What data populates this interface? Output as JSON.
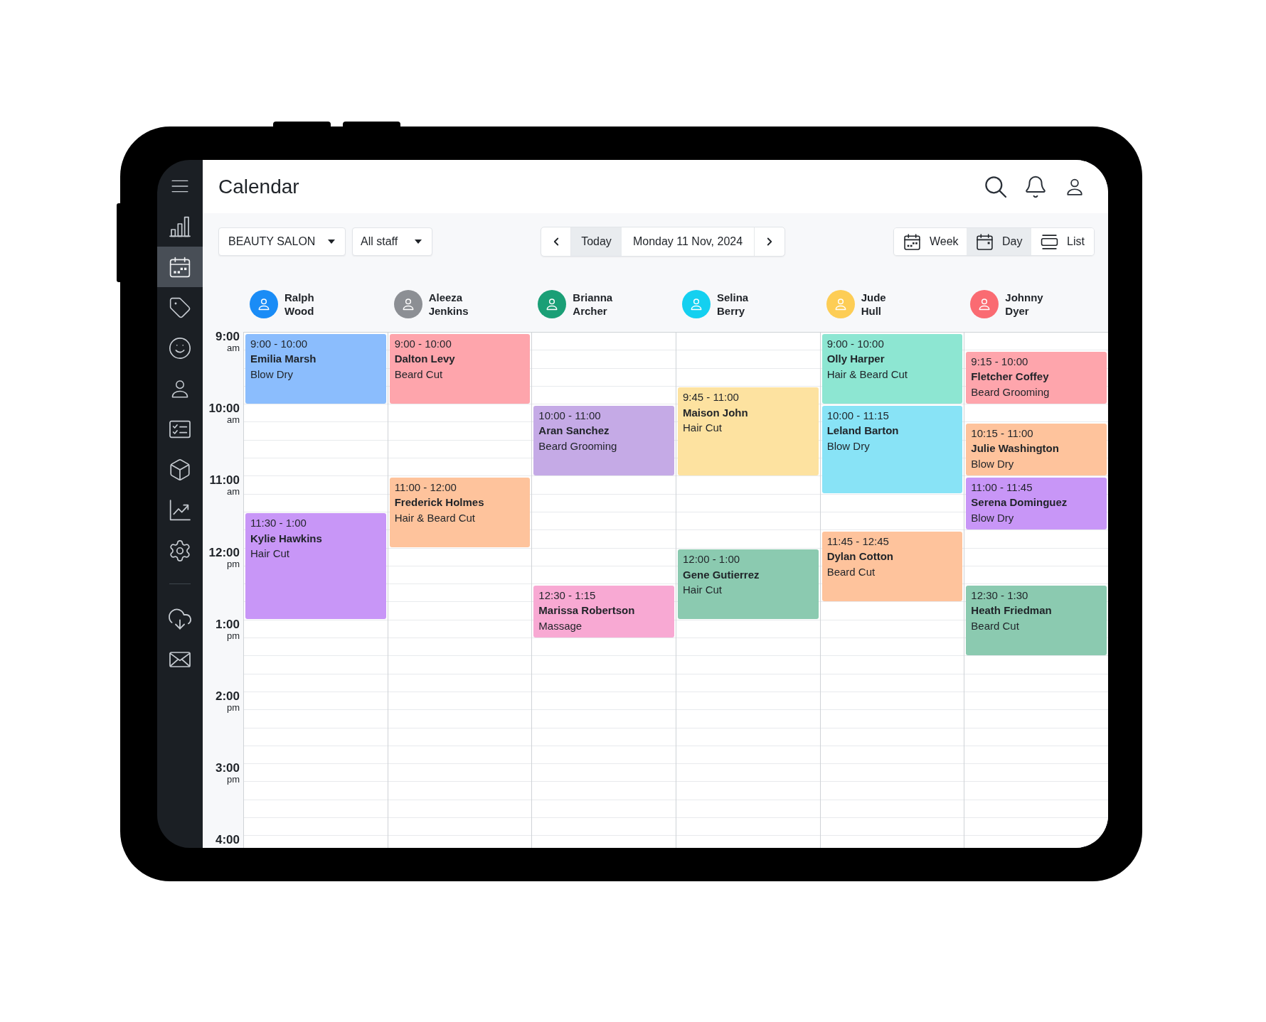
{
  "header": {
    "title": "Calendar"
  },
  "sidebar": {
    "items": [
      {
        "selected": false
      },
      {
        "selected": true
      },
      {
        "selected": false
      },
      {
        "selected": false
      },
      {
        "selected": false
      },
      {
        "selected": false
      },
      {
        "selected": false
      },
      {
        "selected": false
      },
      {
        "selected": false
      }
    ],
    "bottom_items": [
      {
        "selected": false
      },
      {
        "selected": false
      }
    ]
  },
  "toolbar": {
    "location_select": {
      "value": "BEAUTY SALON"
    },
    "staff_select": {
      "value": "All staff"
    },
    "date_nav": {
      "today": {
        "label": "Today",
        "active": true
      },
      "date": "Monday 11 Nov, 2024"
    },
    "views": [
      {
        "label": "Week",
        "selected": false
      },
      {
        "label": "Day",
        "selected": true
      },
      {
        "label": "List",
        "selected": false
      }
    ]
  },
  "time_labels": [
    {
      "hour": "9:00",
      "period": "am"
    },
    {
      "hour": "10:00",
      "period": "am"
    },
    {
      "hour": "11:00",
      "period": "am"
    },
    {
      "hour": "12:00",
      "period": "pm"
    },
    {
      "hour": "1:00",
      "period": "pm"
    },
    {
      "hour": "2:00",
      "period": "pm"
    },
    {
      "hour": "3:00",
      "period": "pm"
    },
    {
      "hour": "4:00"
    }
  ],
  "staff": [
    {
      "name": "Ralph Wood",
      "color": "#1a8cf6",
      "appointments": [
        {
          "time": "9:00 - 10:00",
          "client": "Emilia Marsh",
          "service": "Blow Dry",
          "color": "#8bbdfd"
        },
        {
          "time": "11:30 - 1:00",
          "client": "Kylie Hawkins",
          "service": "Hair Cut",
          "color": "#c896f7"
        }
      ]
    },
    {
      "name": "Aleeza Jenkins",
      "color": "#8c8f94",
      "appointments": [
        {
          "time": "9:00 - 10:00",
          "client": "Dalton Levy",
          "service": "Beard Cut",
          "color": "#fea5ac"
        },
        {
          "time": "11:00 - 12:00",
          "client": "Frederick Holmes",
          "service": "Hair & Beard Cut",
          "color": "#fec39c"
        }
      ]
    },
    {
      "name": "Brianna Archer",
      "color": "#1a9f76",
      "appointments": [
        {
          "time": "10:00 - 11:00",
          "client": "Aran Sanchez",
          "service": "Beard Grooming",
          "color": "#c5aae6"
        },
        {
          "time": "12:30 - 1:15",
          "client": "Marissa Robertson",
          "service": "Massage",
          "color": "#f8a9d3"
        }
      ]
    },
    {
      "name": "Selina Berry",
      "color": "#14d0f0",
      "appointments": [
        {
          "time": "9:45 - 11:00",
          "client": "Maison John",
          "service": "Hair Cut",
          "color": "#fde2a0"
        },
        {
          "time": "12:00 - 1:00",
          "client": "Gene Gutierrez",
          "service": "Hair Cut",
          "color": "#8bcab0"
        }
      ]
    },
    {
      "name": "Jude Hull",
      "color": "#fdcd55",
      "appointments": [
        {
          "time": "9:00 - 10:00",
          "client": "Olly Harper",
          "service": "Hair & Beard Cut",
          "color": "#8de6d2"
        },
        {
          "time": "10:00 - 11:15",
          "client": "Leland Barton",
          "service": "Blow Dry",
          "color": "#88e3f6"
        },
        {
          "time": "11:45 - 12:45",
          "client": "Dylan Cotton",
          "service": "Beard Cut",
          "color": "#fec39c"
        }
      ]
    },
    {
      "name": "Johnny Dyer",
      "color": "#fa6b72",
      "appointments": [
        {
          "time": "9:15 - 10:00",
          "client": "Fletcher Coffey",
          "service": "Beard Grooming",
          "color": "#fea5ac"
        },
        {
          "time": "10:15 - 11:00",
          "client": "Julie Washington",
          "service": "Blow Dry",
          "color": "#fec39c"
        },
        {
          "time": "11:00 - 11:45",
          "client": "Serena Dominguez",
          "service": "Blow Dry",
          "color": "#c896f7"
        },
        {
          "time": "12:30 - 1:30",
          "client": "Heath Friedman",
          "service": "Beard Cut",
          "color": "#8bcab0"
        }
      ]
    }
  ]
}
